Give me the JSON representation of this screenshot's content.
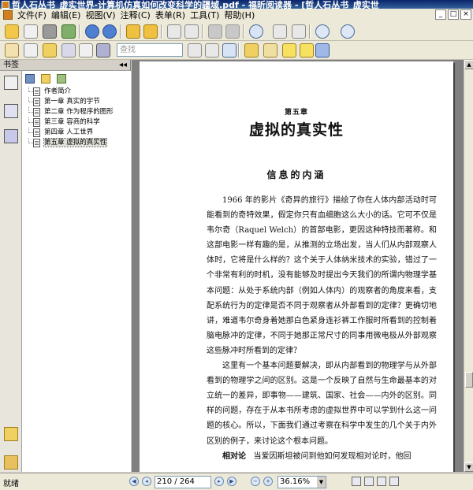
{
  "window": {
    "title": "哲人石丛书_虚实世界-计算机仿真如何改变科学的疆域.pdf - 福昕阅读器 - [哲人石丛书_虚实世"
  },
  "menu": [
    "文件(F)",
    "编辑(E)",
    "视图(V)",
    "注释(C)",
    "表单(R)",
    "工具(T)",
    "帮助(H)"
  ],
  "window_buttons": [
    "_",
    "□",
    "×"
  ],
  "toolbar": {
    "search_placeholder": "查找"
  },
  "bookmarks_panel": {
    "title": "书签",
    "collapse": "◂◂",
    "items": [
      {
        "label": "作者简介",
        "selected": false
      },
      {
        "label": "第一章 真实的宇节",
        "selected": false
      },
      {
        "label": "第二章 作为程序的图形",
        "selected": false
      },
      {
        "label": "第三章 容商的科学",
        "selected": false
      },
      {
        "label": "第四章 人工世界",
        "selected": false
      },
      {
        "label": "第五章 虚拟的真实性",
        "selected": true
      }
    ]
  },
  "document": {
    "chapter_number": "第五章",
    "chapter_title": "虚拟的真实性",
    "section_title": "信息的内涵",
    "para1": "1966 年的影片《奇异的旅行》描绘了你在人体内部活动时可能看到的奇特效果，假定你只有血细胞这么大小的话。它可不仅是韦尔奇（Raquel Welch）的首部电影，更因这种特技而著称。和这部电影一样有趣的是，从推测的立场出发，当人们从内部观察人体时，它将是什么样的？这个关于人体纳米技术的实验，错过了一个非常有利的时机，没有能够及时提出今天我们的所谓内物理学基本问题：从处于系统内部（例如人体内）的观察者的角度来看，支配系统行为的定律是否不同于观察者从外部看到的定律？更确切地讲，难道韦尔奇身着她那白色紧身连衫裤工作服时所看到的控制着脑电脉冲的定律，不同于她那正常尺寸的同事用微电极从外部观察这些脉冲时所看到的定律？",
    "para2": "这里有一个基本问题要解决，即从内部看到的物理学与从外部看到的物理学之间的区别。这是一个反映了自然与生命最基本的对立统一的差异，即事物——建筑、国家、社会——内外的区别。同样的问题，存在于从本书所考虑的虚拟世界中可以学到什么这一问题的核心。所以，下面我们通过考察在科学中发生的几个关于内外区别的例子，来讨论这个根本问题。",
    "para3_lead": "相对论",
    "para3": "当爱因斯坦被问到他如何发现相对论时，他回"
  },
  "status": {
    "text": "就绪",
    "page_indicator": "210 / 264",
    "zoom": "36.16%"
  }
}
